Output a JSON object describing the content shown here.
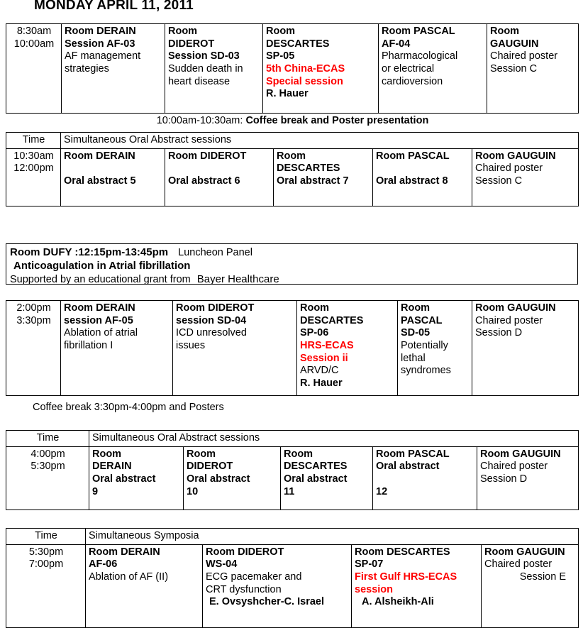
{
  "page": {
    "day_title": "MONDAY APRIL 11, 2011"
  },
  "session_1": {
    "time": {
      "start": "8:30am",
      "end": "10:00am"
    },
    "columns": [
      {
        "room": "Room DERAIN",
        "code": "Session AF-03",
        "desc_lines": [
          "AF management",
          "strategies"
        ]
      },
      {
        "room_lines": [
          "Room",
          "DIDEROT"
        ],
        "code": "Session SD-03",
        "desc_lines": [
          "Sudden death in",
          "heart disease"
        ]
      },
      {
        "room_lines": [
          "Room",
          "DESCARTES"
        ],
        "code": "SP-05",
        "highlight_lines": [
          "5th China-ECAS",
          "Special session"
        ],
        "speaker": "R. Hauer"
      },
      {
        "room": "Room PASCAL",
        "code": "AF-04",
        "desc_lines": [
          "Pharmacological",
          "or electrical",
          "cardioversion"
        ]
      },
      {
        "room_lines": [
          "Room",
          "GAUGUIN"
        ],
        "desc_lines": [
          "Chaired poster",
          "Session C"
        ]
      }
    ],
    "break_row": {
      "time_range": "10:00am-10:30am:",
      "label": "Coffee break and Poster presentation"
    }
  },
  "session_2": {
    "header": {
      "time_label": "Time",
      "span_label": "Simultaneous Oral Abstract sessions"
    },
    "time": {
      "start": "10:30am",
      "end": "12:00pm"
    },
    "columns": [
      {
        "room": "Room DERAIN",
        "abstract": "Oral abstract 5"
      },
      {
        "room": "Room DIDEROT",
        "abstract": "Oral abstract 6"
      },
      {
        "room_lines": [
          "Room",
          "DESCARTES"
        ],
        "abstract": "Oral abstract 7"
      },
      {
        "room": "Room PASCAL",
        "abstract": "Oral abstract 8"
      },
      {
        "room": "Room GAUGUIN",
        "desc_lines": [
          "Chaired poster",
          " Session C"
        ]
      }
    ]
  },
  "luncheon": {
    "line1_bold": "Room DUFY :12:15pm-13:45pm",
    "line1_rest": "Luncheon Panel",
    "line2": "Anticoagulation in Atrial fibrillation",
    "line3_prefix": "Supported by an educational grant from",
    "line3_sponsor": "Bayer Healthcare"
  },
  "session_3": {
    "time": {
      "start": "2:00pm",
      "end": "3:30pm"
    },
    "columns": [
      {
        "room": "Room DERAIN",
        "code": "session AF-05",
        "desc_lines": [
          "Ablation of atrial",
          "fibrillation I"
        ]
      },
      {
        "room": "Room DIDEROT",
        "code": "session SD-04",
        "desc_lines": [
          "ICD unresolved",
          "issues"
        ]
      },
      {
        "room_lines": [
          "Room",
          "DESCARTES"
        ],
        "code": "SP-06",
        "highlight_lines": [
          "HRS-ECAS",
          "Session ii"
        ],
        "sub": " ARVD/C",
        "speaker": "R. Hauer"
      },
      {
        "room_lines": [
          "Room",
          "PASCAL"
        ],
        "code": "SD-05",
        "desc_lines": [
          "Potentially",
          "lethal",
          "syndromes"
        ]
      },
      {
        "room": "Room GAUGUIN",
        "desc_lines": [
          "Chaired poster",
          " Session D"
        ]
      }
    ],
    "coffee_caption": "Coffee break 3:30pm-4:00pm  and Posters"
  },
  "session_4": {
    "header": {
      "time_label": "Time",
      "span_label": "Simultaneous Oral Abstract sessions"
    },
    "time": {
      "start": "4:00pm",
      "end": "5:30pm"
    },
    "columns": [
      {
        "room_lines": [
          "Room",
          "DERAIN"
        ],
        "abstract_lines": [
          "Oral abstract",
          "9"
        ]
      },
      {
        "room_lines": [
          "Room",
          "DIDEROT"
        ],
        "abstract_lines": [
          "Oral abstract",
          "10"
        ]
      },
      {
        "room_lines": [
          "Room",
          "DESCARTES"
        ],
        "abstract_lines": [
          "Oral abstract",
          "11"
        ]
      },
      {
        "room": "Room PASCAL",
        "abstract_lines": [
          "Oral abstract",
          "",
          "12"
        ]
      },
      {
        "room": "Room GAUGUIN",
        "desc_lines": [
          "Chaired poster",
          " Session D"
        ]
      }
    ]
  },
  "session_5": {
    "header": {
      "time_label": "Time",
      "span_label": "Simultaneous Symposia"
    },
    "time": {
      "start": "5:30pm",
      "end": "7:00pm"
    },
    "columns": [
      {
        "room": "Room DERAIN",
        "code": " AF-06",
        "desc_lines": [
          "Ablation of AF (II)"
        ]
      },
      {
        "room": "Room DIDEROT",
        "code": " WS-04",
        "desc_lines": [
          " ECG pacemaker and",
          "CRT dysfunction"
        ],
        "speaker": "E. Ovsyshcher-C. Israel"
      },
      {
        "room": "Room DESCARTES",
        "code": "SP-07",
        "highlight_lines": [
          "First Gulf HRS-ECAS",
          "session"
        ],
        "speaker": "A.  Alsheikh-Ali"
      },
      {
        "room": "Room GAUGUIN",
        "desc_lines": [
          "Chaired poster",
          "Session E"
        ]
      }
    ]
  },
  "colors": {
    "highlight": "#ff0000",
    "text": "#000000",
    "border": "#000000",
    "background": "#ffffff"
  }
}
